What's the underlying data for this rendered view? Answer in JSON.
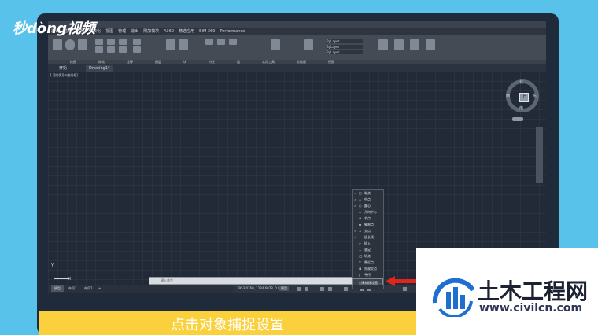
{
  "watermark": {
    "logo_text": "秒dòng视频"
  },
  "cad": {
    "menubar": [
      "默认",
      "插入",
      "注释",
      "参数化",
      "视图",
      "管理",
      "输出",
      "附加模块",
      "A360",
      "精选应用",
      "BIM 360",
      "Performance"
    ],
    "panels": [
      "绘图",
      "修改",
      "注释",
      "图层",
      "块",
      "特性",
      "组",
      "实用工具",
      "剪贴板",
      "视图"
    ],
    "layer_values": [
      "ByLayer",
      "ByLayer",
      "ByLayer"
    ],
    "tabs": [
      "开始",
      "Drawing1*"
    ],
    "viewport_label": "[-][俯视][二维线框]",
    "viewcube": {
      "north": "北",
      "south": "南",
      "east": "东",
      "west": "西",
      "face": "上",
      "wcs": "WCS"
    },
    "ucs": {
      "x": "X",
      "y": "Y"
    },
    "command_placeholder": "键入命令",
    "layout_tabs": [
      "模型",
      "布局1",
      "布局2",
      "+"
    ],
    "coords": "3953.0760, 1234.6078, 0.0000",
    "model_label": "模型"
  },
  "snap_menu": {
    "items": [
      {
        "label": "端点",
        "checked": true
      },
      {
        "label": "中点",
        "checked": true
      },
      {
        "label": "圆心",
        "checked": true
      },
      {
        "label": "几何中心",
        "checked": false
      },
      {
        "label": "节点",
        "checked": false
      },
      {
        "label": "象限点",
        "checked": false
      },
      {
        "label": "交点",
        "checked": true
      },
      {
        "label": "延长线",
        "checked": true
      },
      {
        "label": "插入",
        "checked": false
      },
      {
        "label": "垂足",
        "checked": false
      },
      {
        "label": "切点",
        "checked": false
      },
      {
        "label": "最近点",
        "checked": false
      },
      {
        "label": "外观交点",
        "checked": false
      },
      {
        "label": "平行",
        "checked": false
      }
    ],
    "settings_label": "对象捕捉设置..."
  },
  "caption": "点击对象捕捉设置",
  "brand": {
    "name": "土木工程网",
    "url": "www.civilcn.com"
  },
  "colors": {
    "background": "#58c2ea",
    "caption_bar": "#fbd03d",
    "arrow": "#e0261b",
    "brand_blue": "#1f6fd1"
  }
}
